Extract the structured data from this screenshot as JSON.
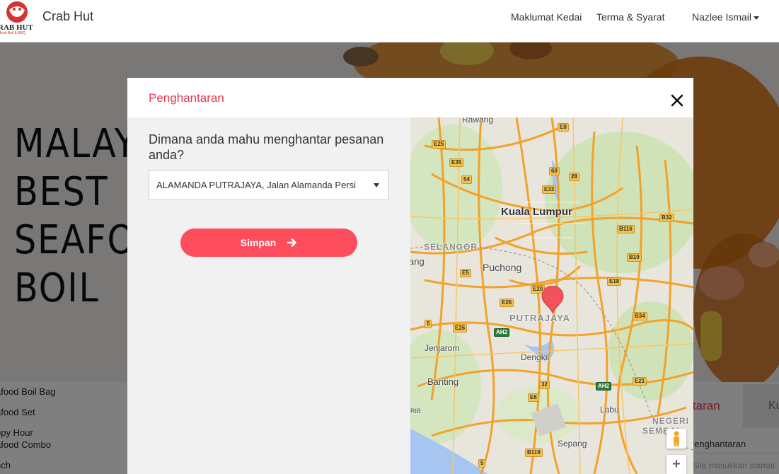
{
  "header": {
    "brand": "Crab Hut",
    "nav": [
      {
        "label": "Maklumat Kedai"
      },
      {
        "label": "Terma & Syarat"
      }
    ],
    "user_name": "Nazlee Ismail"
  },
  "hero": {
    "title_lines": [
      "MALAY",
      "BEST",
      "SEAFO",
      "BOIL"
    ]
  },
  "categories": [
    "afood Boil Bag",
    "afood Set",
    "ppy Hour\nafood Combo",
    "nch"
  ],
  "right_panel": {
    "delivery_label": "antaran",
    "grey_button": "Ku",
    "address_label": "at Penghantaran",
    "address_placeholder": "Sila masukkan alamat"
  },
  "modal": {
    "title": "Penghantaran",
    "question": "Dimana anda mahu menghantar pesanan anda?",
    "selected_address": "ALAMANDA PUTRAJAYA, Jalan Alamanda Persi",
    "save_label": "Simpan",
    "colors": {
      "accent": "#fd4c5c",
      "title": "#e8384f"
    }
  },
  "map": {
    "cities": [
      "Kuala Lumpur",
      "Puchong",
      "PUTRAJAYA"
    ],
    "towns": [
      "Rawang",
      "Jenjarom",
      "Dengkil",
      "Banting",
      "Labu",
      "Sepang",
      "ang"
    ],
    "states": [
      "SELANGOR",
      "NEGERI",
      "SEMBAI"
    ],
    "highway_shields": [
      "E8",
      "E25",
      "E35",
      "54",
      "68",
      "28",
      "E33",
      "B32",
      "B116",
      "B19",
      "E5",
      "E18",
      "E20",
      "E26",
      "AH2",
      "B34",
      "5",
      "E26",
      "AH2",
      "32",
      "E21",
      "E6",
      "RIB",
      "B119",
      "5"
    ],
    "zoom_in": "+"
  }
}
